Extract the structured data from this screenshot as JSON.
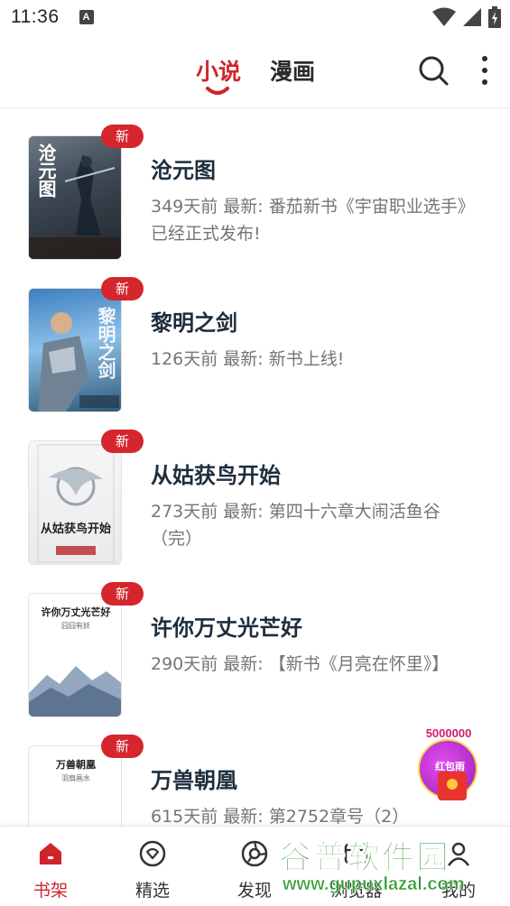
{
  "status_bar": {
    "time": "11:36",
    "notification_letter": "A"
  },
  "header": {
    "tabs": [
      {
        "label": "小说",
        "active": true
      },
      {
        "label": "漫画",
        "active": false
      }
    ],
    "search_icon": "search-icon",
    "more_icon": "more-vertical-icon"
  },
  "books": [
    {
      "title": "沧元图",
      "badge": "新",
      "description": "349天前 最新: 番茄新书《宇宙职业选手》已经正式发布!",
      "cover_text": "沧元图"
    },
    {
      "title": "黎明之剑",
      "badge": "新",
      "description": "126天前 最新: 新书上线!",
      "cover_text": "黎明之剑"
    },
    {
      "title": "从姑获鸟开始",
      "badge": "新",
      "description": "273天前 最新: 第四十六章大闹活鱼谷（完）",
      "cover_text": "从姑获鸟开始"
    },
    {
      "title": "许你万丈光芒好",
      "badge": "新",
      "description": "290天前 最新: 【新书《月亮在怀里》】",
      "cover_text": "许你万丈光芒好",
      "cover_subtext": "囧囧有妖"
    },
    {
      "title": "万兽朝凰",
      "badge": "新",
      "description": "615天前 最新: 第2752章号（2）",
      "cover_text": "万兽朝凰",
      "cover_subtext": "羽扇画水"
    }
  ],
  "promo": {
    "count": "5000000",
    "label": "红包雨"
  },
  "bottom_nav": [
    {
      "label": "书架",
      "icon": "home-icon",
      "active": true
    },
    {
      "label": "精选",
      "icon": "heart-circle-icon",
      "active": false
    },
    {
      "label": "发现",
      "icon": "compass-icon",
      "active": false
    },
    {
      "label": "浏览器",
      "icon": "browser-icon",
      "active": false
    },
    {
      "label": "我的",
      "icon": "user-icon",
      "active": false
    }
  ],
  "watermark": {
    "title": "谷普软件园",
    "url": "www.gupuxlazal.com"
  },
  "colors": {
    "accent": "#d0242b",
    "title_text": "#1e2d3c",
    "secondary_text": "#757575",
    "badge": "#d5262d",
    "watermark_green": "#2f9a2f"
  }
}
